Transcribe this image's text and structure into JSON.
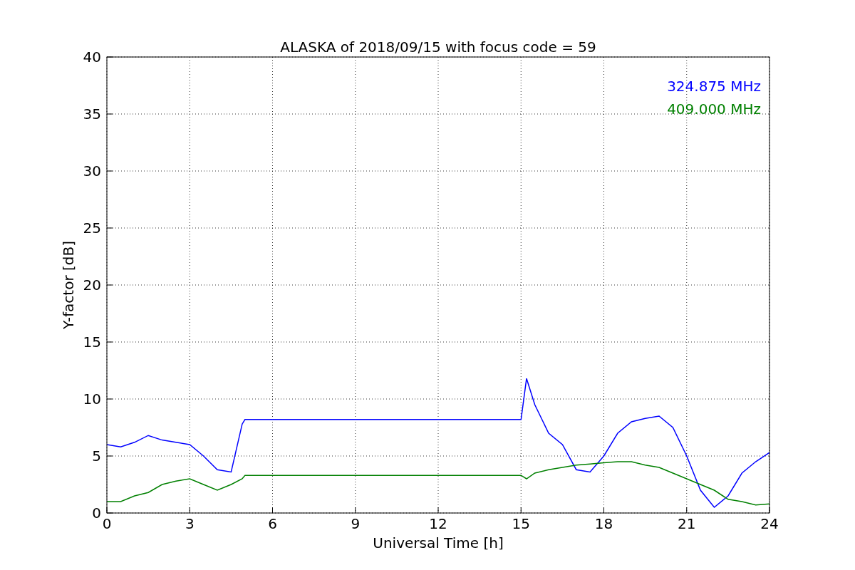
{
  "figure": {
    "chart_data": {
      "type": "line",
      "title": "ALASKA of 2018/09/15 with focus code = 59",
      "xlabel": "Universal Time [h]",
      "ylabel": "Y-factor [dB]",
      "x": [
        0,
        0.5,
        1,
        1.5,
        2,
        2.5,
        3,
        3.5,
        4,
        4.5,
        4.9,
        5,
        15,
        15.2,
        15.5,
        16,
        16.5,
        17,
        17.5,
        18,
        18.5,
        19,
        19.5,
        20,
        20.5,
        21,
        21.5,
        22,
        22.5,
        23,
        23.5,
        24
      ],
      "series": [
        {
          "name": "324.875 MHz",
          "color": "#0000ff",
          "values": [
            6,
            5.8,
            6.2,
            6.8,
            6.4,
            6.2,
            6,
            5,
            3.8,
            3.6,
            7.8,
            8.2,
            8.2,
            11.8,
            9.5,
            7,
            6,
            3.8,
            3.6,
            5,
            7,
            8,
            8.3,
            8.5,
            7.5,
            5,
            2,
            0.5,
            1.5,
            3.5,
            4.5,
            5.3
          ]
        },
        {
          "name": "409.000 MHz",
          "color": "#008000",
          "values": [
            1,
            1,
            1.5,
            1.8,
            2.5,
            2.8,
            3,
            2.5,
            2,
            2.5,
            3,
            3.3,
            3.3,
            3,
            3.5,
            3.8,
            4,
            4.2,
            4.3,
            4.4,
            4.5,
            4.5,
            4.2,
            4,
            3.5,
            3,
            2.5,
            2,
            1.2,
            1,
            0.7,
            0.8
          ]
        }
      ],
      "xlim": [
        0,
        24
      ],
      "ylim": [
        0,
        40
      ],
      "xticks": [
        0,
        3,
        6,
        9,
        12,
        15,
        18,
        21,
        24
      ],
      "yticks": [
        0,
        5,
        10,
        15,
        20,
        25,
        30,
        35,
        40
      ],
      "grid": true
    }
  }
}
